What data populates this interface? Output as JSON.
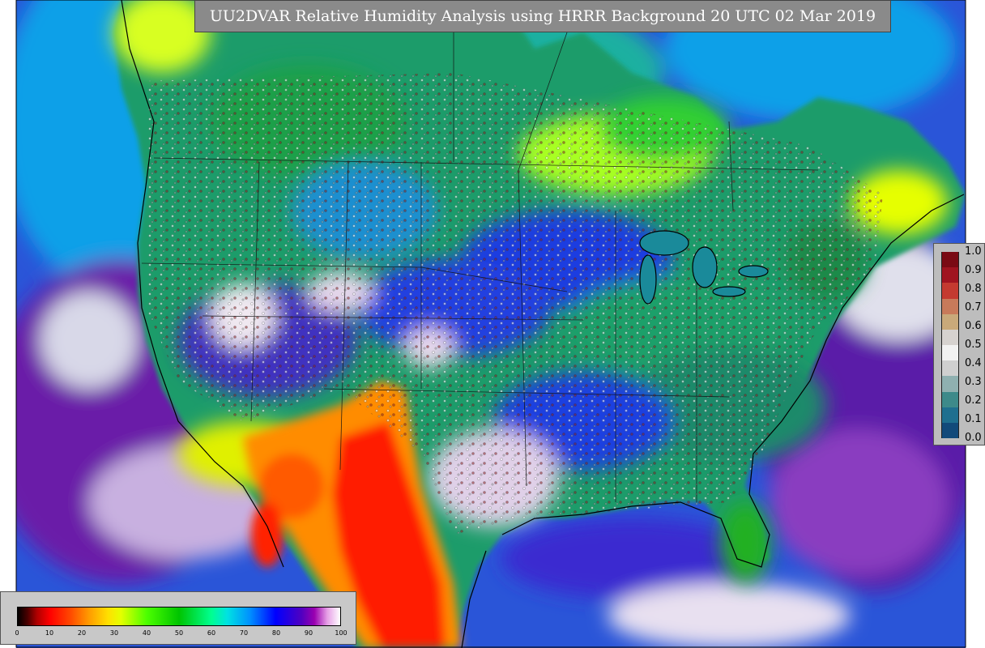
{
  "title": "UU2DVAR Relative Humidity Analysis using HRRR Background 20 UTC 02 Mar 2019",
  "rh_legend": {
    "labels": [
      "1.0",
      "0.9",
      "0.8",
      "0.7",
      "0.6",
      "0.5",
      "0.4",
      "0.3",
      "0.2",
      "0.1",
      "0.0"
    ],
    "colors": [
      "#7a0a14",
      "#a01420",
      "#c43a30",
      "#c87a5a",
      "#c9a97a",
      "#d6d2cf",
      "#f2f2f2",
      "#cfcfcf",
      "#8fb0b0",
      "#3d8a8a",
      "#1f6f8f",
      "#124a7a"
    ]
  },
  "percent_colorbar": {
    "ticks": [
      "0",
      "10",
      "20",
      "30",
      "40",
      "50",
      "60",
      "70",
      "80",
      "90",
      "100"
    ]
  },
  "colors": {
    "ocean": "#2a55d8",
    "land_green": "#1fa43a",
    "dry_red": "#ff1e00",
    "dry_orange": "#ff8c00",
    "moist_purple": "#6a1aa8",
    "pale": "#d8c8e8"
  }
}
